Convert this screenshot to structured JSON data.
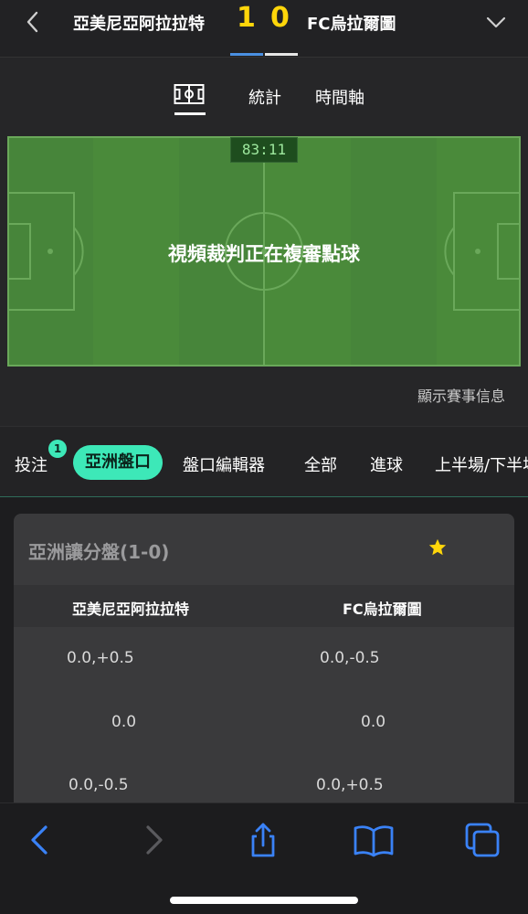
{
  "header": {
    "home_team": "亞美尼亞阿拉拉特",
    "away_team": "FC烏拉爾圖",
    "home_score": "1",
    "away_score": "0"
  },
  "view_tabs": {
    "stats": "統計",
    "timeline": "時間軸"
  },
  "pitch": {
    "clock": "83:11",
    "message": "視頻裁判正在複審點球",
    "show_info": "顯示賽事信息"
  },
  "market_tabs": {
    "bet": "投注",
    "bet_badge": "1",
    "asian": "亞洲盤口",
    "editor": "盤口編輯器",
    "all": "全部",
    "goals": "進球",
    "half": "上半場/下半場"
  },
  "market": {
    "title": "亞洲讓分盤(1-0)",
    "col_home": "亞美尼亞阿拉拉特",
    "col_away": "FC烏拉爾圖",
    "rows": [
      {
        "home": "0.0,+0.5",
        "away": "0.0,-0.5"
      },
      {
        "home": "0.0",
        "away": "0.0"
      },
      {
        "home": "0.0,-0.5",
        "away": "0.0,+0.5"
      }
    ]
  },
  "colors": {
    "score": "#ffd60a",
    "accent": "#3de8b8",
    "pitch": "#4a8a3a",
    "toolbar_icon": "#3a82f7"
  },
  "icons": [
    "back-chevron-icon",
    "expand-chevron-icon",
    "field-icon",
    "star-icon",
    "browser-back-icon",
    "browser-forward-icon",
    "share-icon",
    "bookmarks-icon",
    "tabs-icon"
  ]
}
